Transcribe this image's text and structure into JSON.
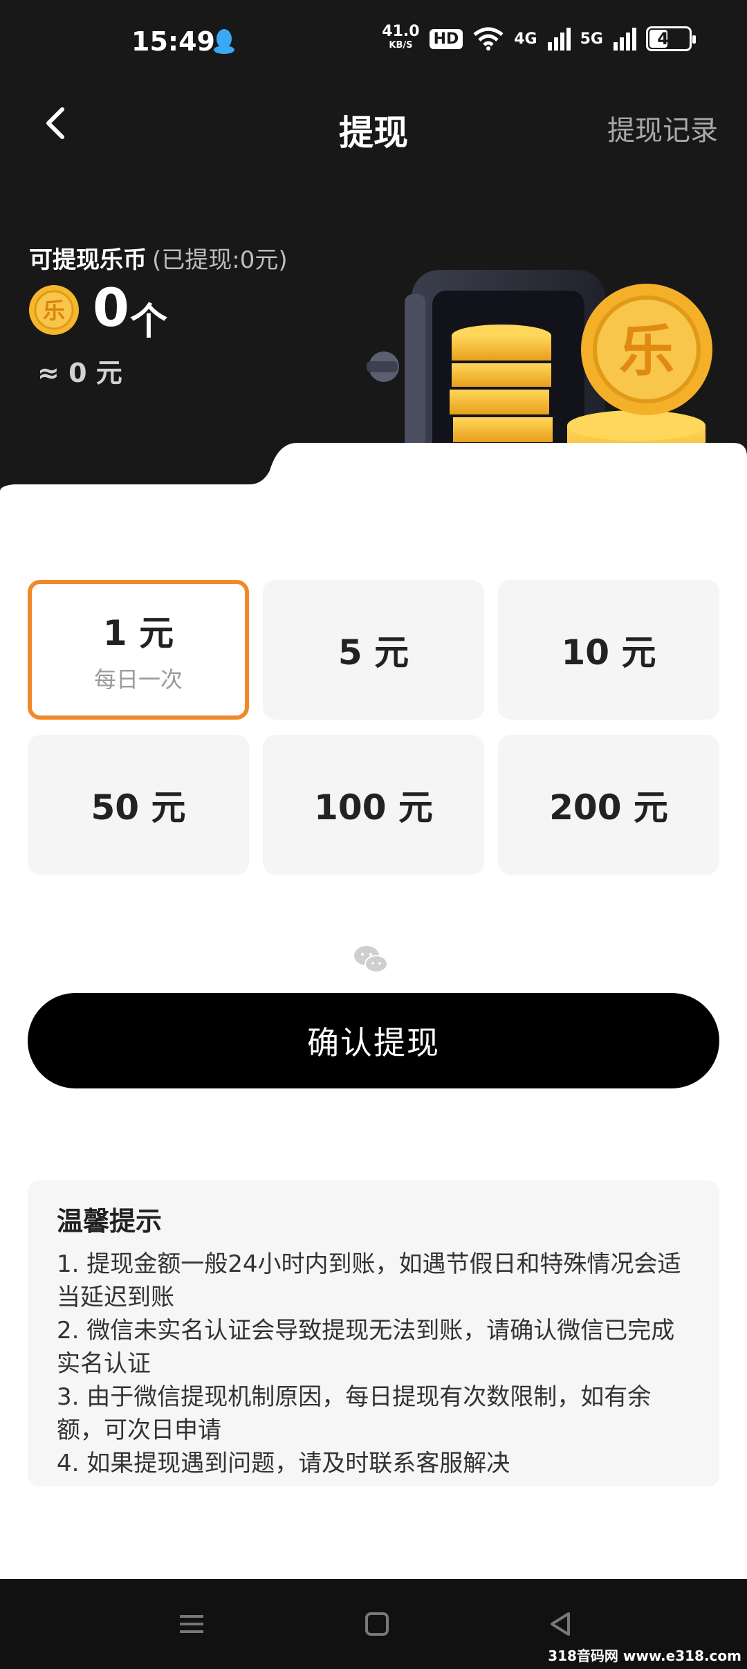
{
  "status_bar": {
    "time": "15:49",
    "speed_value": "41.0",
    "speed_unit": "KB/S",
    "hd": "HD",
    "net1": "4G",
    "net2": "5G",
    "battery": "47"
  },
  "nav": {
    "title": "提现",
    "right_link": "提现记录"
  },
  "balance": {
    "label": "可提现乐币",
    "withdrawn": "(已提现:0元)",
    "amount": "0",
    "unit": "个",
    "approx": "≈ 0 元",
    "coin_glyph": "乐"
  },
  "options": [
    {
      "value": "1 元",
      "note": "每日一次",
      "selected": true
    },
    {
      "value": "5 元",
      "note": "",
      "selected": false
    },
    {
      "value": "10 元",
      "note": "",
      "selected": false
    },
    {
      "value": "50 元",
      "note": "",
      "selected": false
    },
    {
      "value": "100 元",
      "note": "",
      "selected": false
    },
    {
      "value": "200 元",
      "note": "",
      "selected": false
    }
  ],
  "confirm_label": "确认提现",
  "tips": {
    "title": "温馨提示",
    "items": [
      "1. 提现金额一般24小时内到账，如遇节假日和特殊情况会适当延迟到账",
      "2. 微信未实名认证会导致提现无法到账，请确认微信已完成实名认证",
      "3. 由于微信提现机制原因，每日提现有次数限制，如有余额，可次日申请",
      "4. 如果提现遇到问题，请及时联系客服解决"
    ]
  },
  "watermark": "318音码网 www.e318.com",
  "colors": {
    "header_bg": "#181818",
    "accent_orange": "#f0892a",
    "coin_gold": "#f5b72b",
    "button_bg": "#000000"
  }
}
